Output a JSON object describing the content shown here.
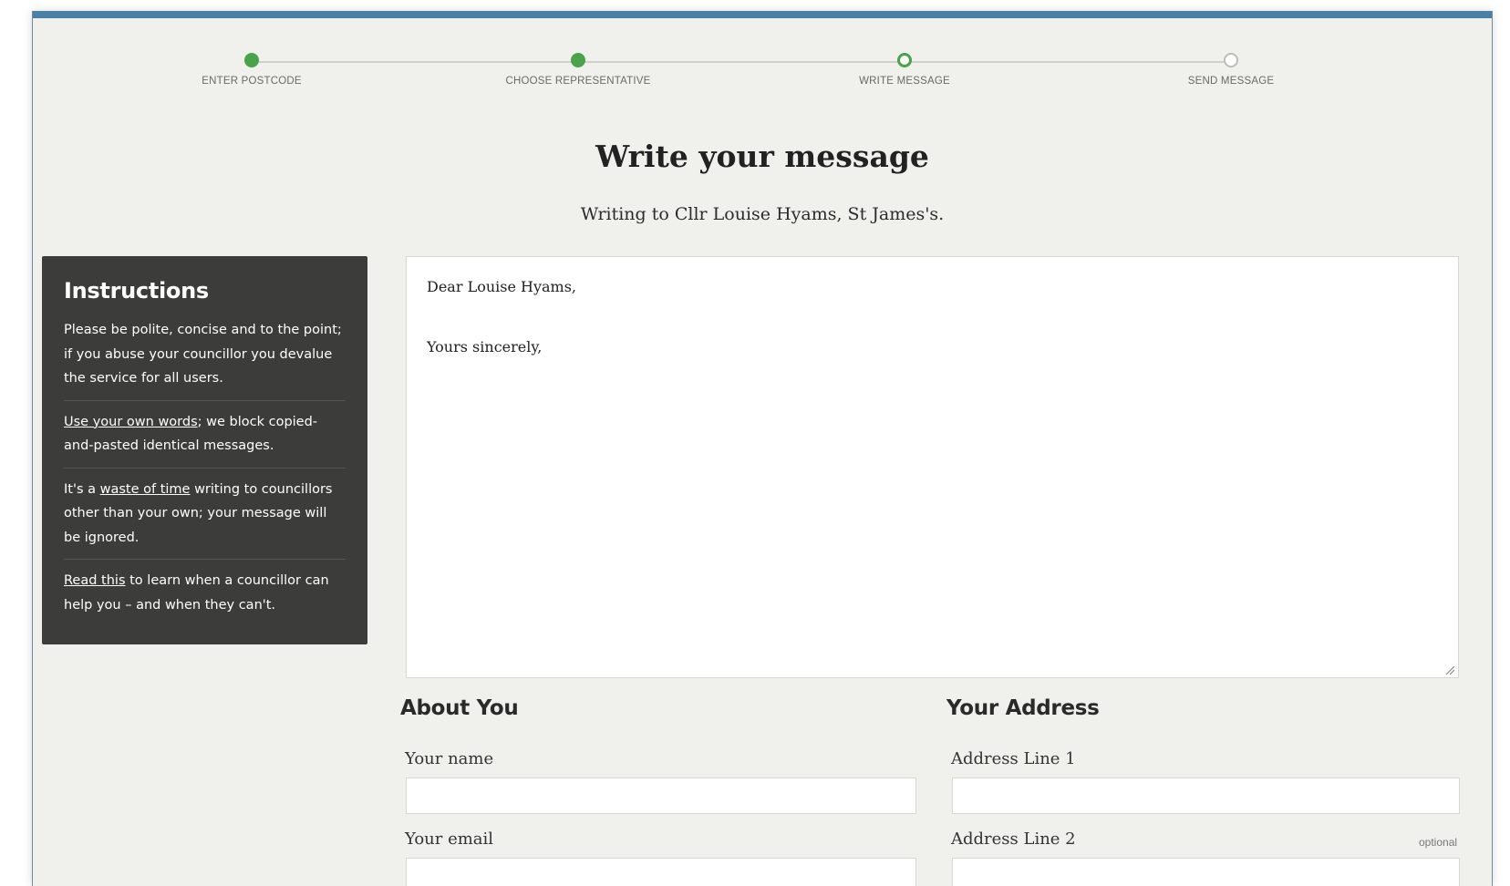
{
  "colors": {
    "accent_bar": "#4a7fa6",
    "step_green": "#4aa34a",
    "panel_dark": "#3c3c3b",
    "page_bg": "#f0f0ec"
  },
  "steps": [
    {
      "label": "ENTER POSTCODE",
      "state": "done"
    },
    {
      "label": "CHOOSE REPRESENTATIVE",
      "state": "done"
    },
    {
      "label": "WRITE MESSAGE",
      "state": "current"
    },
    {
      "label": "SEND MESSAGE",
      "state": "todo"
    }
  ],
  "page": {
    "title": "Write your message",
    "subtitle": "Writing to Cllr Louise Hyams, St James's."
  },
  "instructions": {
    "heading": "Instructions",
    "p1": "Please be polite, concise and to the point; if you abuse your councillor you devalue the service for all users.",
    "p2_link": "Use your own words",
    "p2_rest": "; we block copied-and-pasted identical messages.",
    "p3_start": "It's a ",
    "p3_link": "waste of time",
    "p3_rest": " writing to councillors other than your own; your message will be ignored.",
    "p4_link": "Read this",
    "p4_rest": " to learn when a councillor can help you – and when they can't."
  },
  "message": {
    "greeting": "Dear Louise Hyams,",
    "signoff": "Yours sincerely,"
  },
  "about_you": {
    "heading": "About You",
    "name_label": "Your name",
    "name_value": "",
    "email_label": "Your email",
    "email_value": ""
  },
  "address": {
    "heading": "Your Address",
    "line1_label": "Address Line 1",
    "line1_value": "",
    "line2_label": "Address Line 2",
    "line2_optional": "optional",
    "line2_value": ""
  }
}
